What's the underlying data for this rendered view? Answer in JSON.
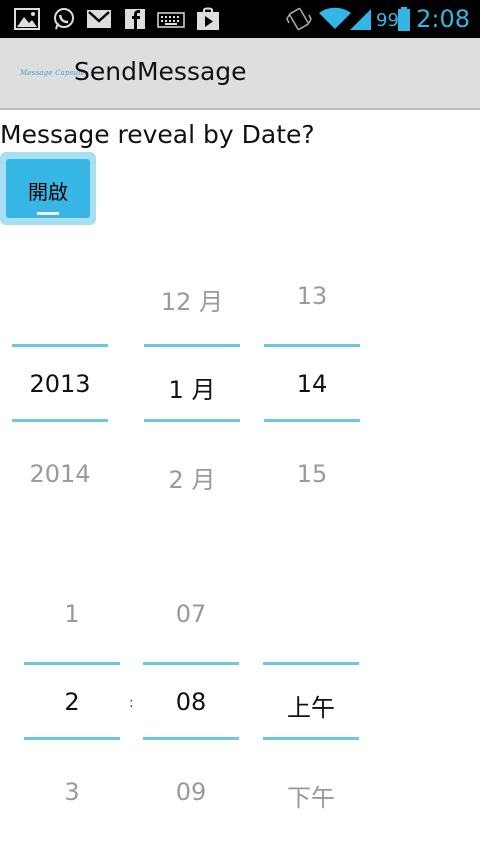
{
  "status_bar": {
    "battery_level": "99",
    "time": "2:08",
    "left_icons": [
      "gallery-icon",
      "whatsapp-icon",
      "gmail-icon",
      "facebook-icon",
      "keyboard-icon",
      "play-store-icon"
    ],
    "right_icons": [
      "vibrate-icon",
      "wifi-icon",
      "signal-icon",
      "battery-icon"
    ]
  },
  "action_bar": {
    "logo_text": "Message Capsule",
    "title": "SendMessage"
  },
  "content": {
    "prompt": "Message reveal by Date?",
    "toggle_label": "開啟"
  },
  "date_picker": {
    "year": {
      "prev": "",
      "current": "2013",
      "next": "2014"
    },
    "month": {
      "prev": "12 月",
      "current": "1 月",
      "next": "2 月"
    },
    "day": {
      "prev": "13",
      "current": "14",
      "next": "15"
    }
  },
  "time_picker": {
    "hour": {
      "prev": "1",
      "current": "2",
      "next": "3"
    },
    "separator": ":",
    "minute": {
      "prev": "07",
      "current": "08",
      "next": "09"
    },
    "ampm": {
      "prev": "",
      "current": "上午",
      "next": "下午"
    }
  },
  "colors": {
    "accent": "#33b5e5",
    "divider": "#6fc6e3",
    "toggle_on": "#38b6e6"
  }
}
